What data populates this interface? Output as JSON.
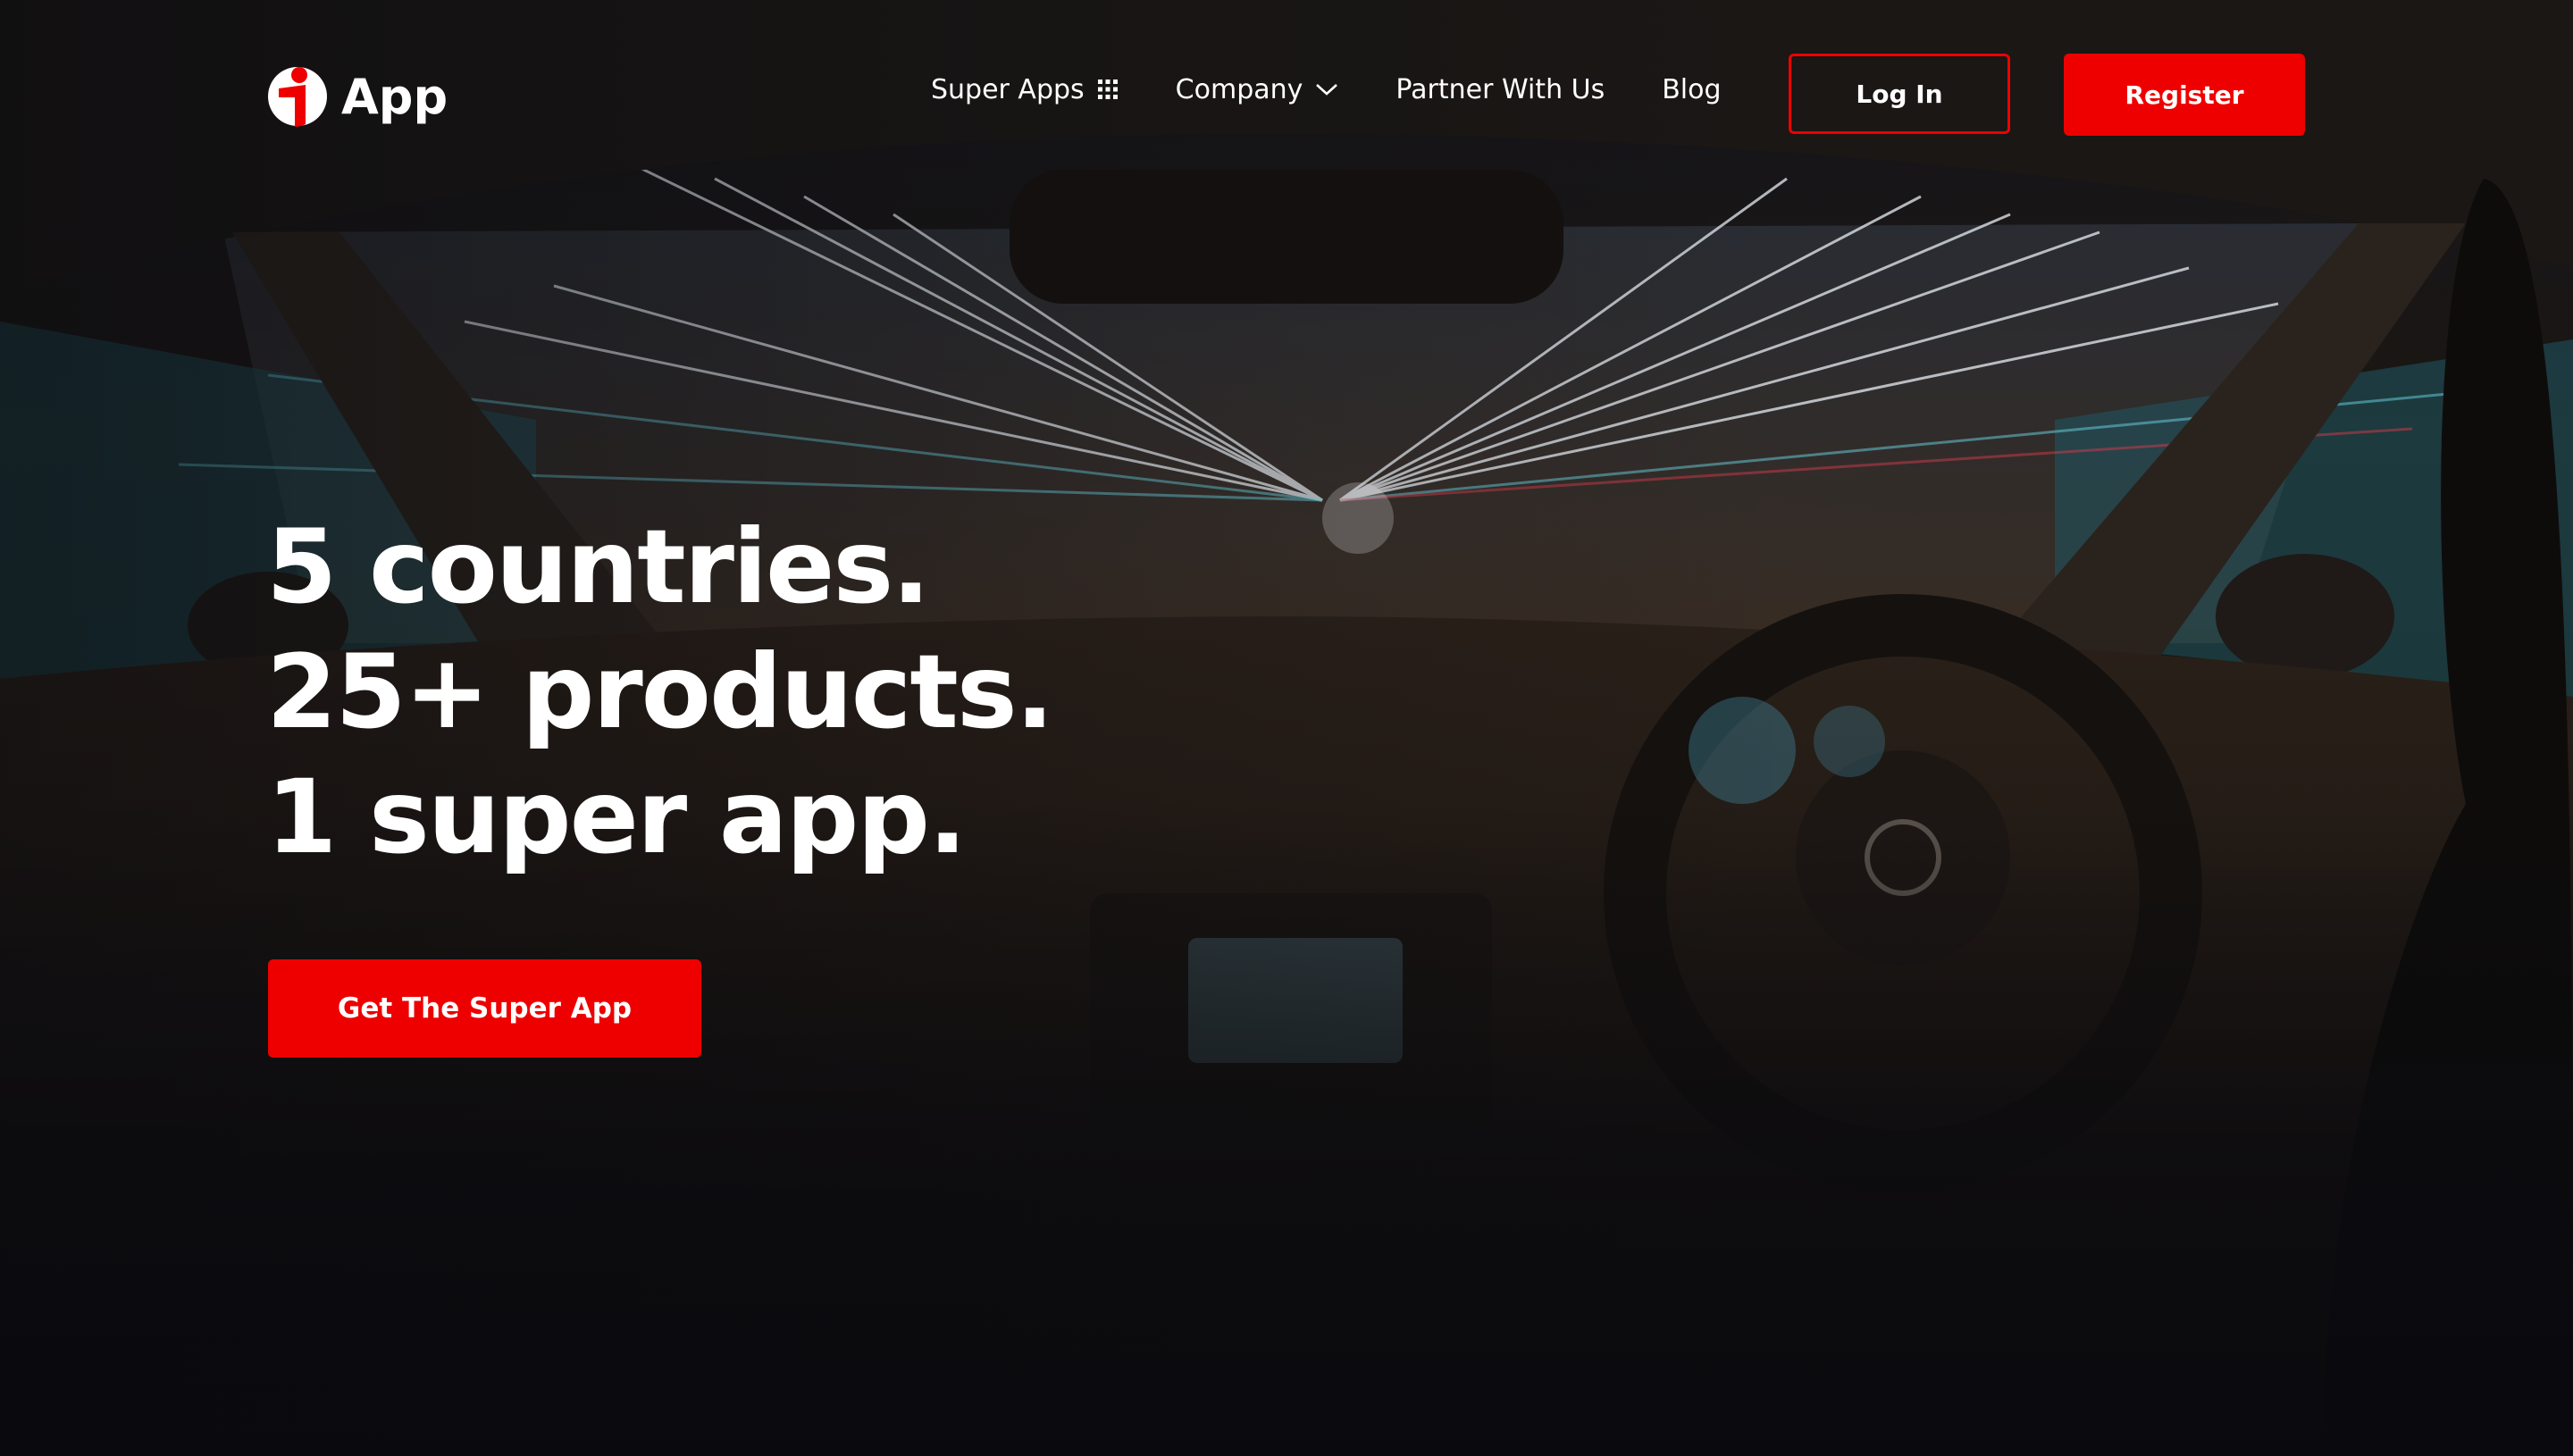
{
  "brand": {
    "logo_text": "App",
    "logo_icon": "i-logo-icon",
    "accent_color": "#ee0000"
  },
  "nav": {
    "items": [
      {
        "label": "Super Apps",
        "icon": "grid-icon"
      },
      {
        "label": "Company",
        "icon": "chevron-down-icon"
      },
      {
        "label": "Partner With Us"
      },
      {
        "label": "Blog"
      }
    ],
    "login_label": "Log In",
    "register_label": "Register"
  },
  "hero": {
    "headline": [
      "5 countries.",
      "25+ products.",
      "1 super app."
    ],
    "cta_label": "Get The Super App",
    "background": "car-interior-night-drive-photo"
  }
}
